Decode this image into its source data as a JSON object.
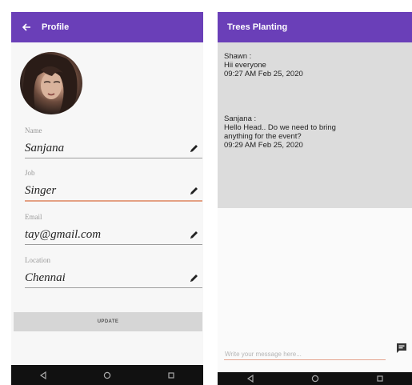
{
  "profile": {
    "title": "Profile",
    "fields": [
      {
        "label": "Name",
        "value": "Sanjana"
      },
      {
        "label": "Job",
        "value": "Singer"
      },
      {
        "label": "Email",
        "value": "tay@gmail.com"
      },
      {
        "label": "Location",
        "value": "Chennai"
      }
    ],
    "update_label": "UPDATE"
  },
  "chat": {
    "title": "Trees Planting",
    "messages": [
      {
        "sender": "Shawn  :",
        "text": "Hii everyone",
        "time": "09:27 AM   Feb 25, 2020"
      },
      {
        "sender": "Sanjana :",
        "text_lines": [
          "Hello Head.. Do we need to bring",
          "anything for the event?"
        ],
        "time": "09:29 AM   Feb 25, 2020"
      }
    ],
    "input_placeholder": "Write your message here..."
  },
  "colors": {
    "app_bar": "#6a3fb8",
    "accent": "#e4a184",
    "chat_bg": "#dcdcdc",
    "nav_bar": "#111111"
  },
  "icons": {
    "back": "arrow-left-icon",
    "edit": "pencil-icon",
    "send": "message-icon",
    "nav": [
      "back-triangle-icon",
      "home-circle-icon",
      "recents-square-icon"
    ]
  }
}
